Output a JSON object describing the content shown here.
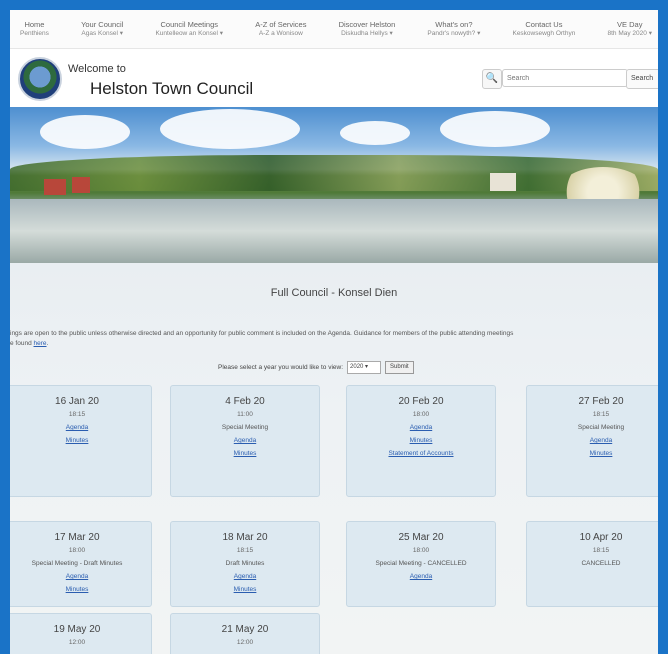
{
  "nav": [
    {
      "label": "Home",
      "sub": "Penthiens"
    },
    {
      "label": "Your Council",
      "sub": "Agas Konsel ▾"
    },
    {
      "label": "Council Meetings",
      "sub": "Kuntelleow an Konsel ▾"
    },
    {
      "label": "A-Z of Services",
      "sub": "A-Z a Wonisow"
    },
    {
      "label": "Discover Helston",
      "sub": "Diskudha Hellys ▾"
    },
    {
      "label": "What's on?",
      "sub": "Pandr's nowyth? ▾"
    },
    {
      "label": "Contact Us",
      "sub": "Keskowsewgh Orthyn"
    },
    {
      "label": "VE Day",
      "sub": "8th May 2020 ▾"
    }
  ],
  "header": {
    "welcome": "Welcome to",
    "title": "Helston Town Council",
    "search_placeholder": "Search",
    "search_button": "Search"
  },
  "main": {
    "title": "Full Council - Konsel Dien",
    "intro_text": "ings are open to the public unless otherwise directed and an opportunity for public comment is included on the Agenda.  Guidance for members of the public attending meetings",
    "intro_text2": "e found",
    "intro_link": "here",
    "year_prompt": "Please select a year you would like to view:",
    "year_value": "2020",
    "year_submit": "Submit"
  },
  "meetings": [
    {
      "date": "16 Jan 20",
      "time": "18:15",
      "status": "",
      "links": [
        "Agenda",
        "Minutes"
      ]
    },
    {
      "date": "4 Feb 20",
      "time": "11:00",
      "status": "Special Meeting",
      "links": [
        "Agenda",
        "Minutes"
      ]
    },
    {
      "date": "20 Feb 20",
      "time": "18:00",
      "status": "",
      "links": [
        "Agenda",
        "Minutes",
        "Statement of Accounts"
      ]
    },
    {
      "date": "27 Feb 20",
      "time": "18:15",
      "status": "Special Meeting",
      "links": [
        "Agenda",
        "Minutes"
      ]
    },
    {
      "date": "17 Mar 20",
      "time": "18:00",
      "status": "Special Meeting - Draft Minutes",
      "links": [
        "Agenda",
        "Minutes"
      ]
    },
    {
      "date": "18 Mar 20",
      "time": "18:15",
      "status": "Draft Minutes",
      "links": [
        "Agenda",
        "Minutes"
      ]
    },
    {
      "date": "25 Mar 20",
      "time": "18:00",
      "status": "Special Meeting - CANCELLED",
      "links": [
        "Agenda"
      ]
    },
    {
      "date": "10 Apr 20",
      "time": "18:15",
      "status": "CANCELLED",
      "links": []
    },
    {
      "date": "19 May 20",
      "time": "12:00",
      "status": "",
      "links": []
    },
    {
      "date": "21 May 20",
      "time": "12:00",
      "status": "",
      "links": []
    }
  ],
  "icons": {
    "search": "search-icon",
    "crest": "crest-logo"
  }
}
